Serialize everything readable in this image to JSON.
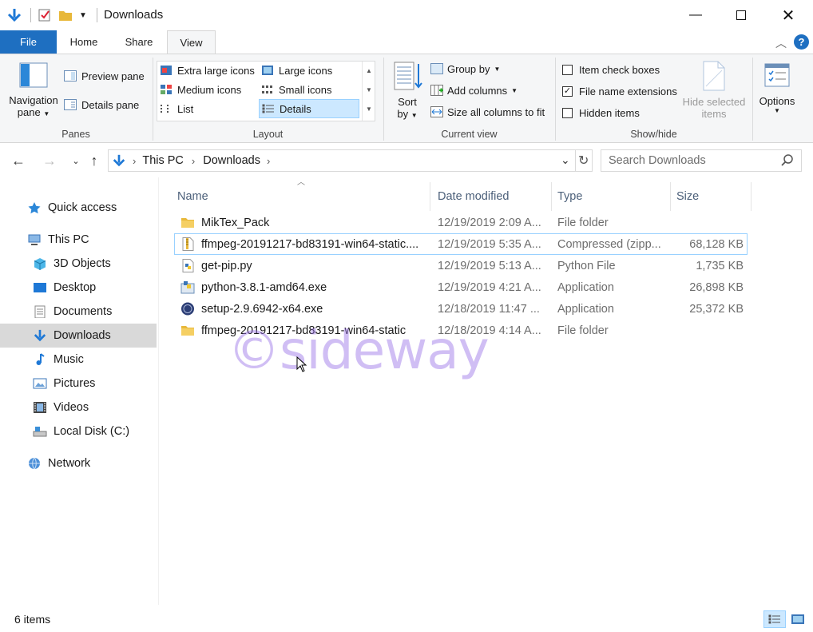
{
  "window": {
    "title": "Downloads"
  },
  "tabs": [
    {
      "label": "File"
    },
    {
      "label": "Home"
    },
    {
      "label": "Share"
    },
    {
      "label": "View"
    }
  ],
  "ribbon": {
    "panes": {
      "label": "Panes",
      "navigation_pane_line1": "Navigation",
      "navigation_pane_line2": "pane",
      "preview_pane": "Preview pane",
      "details_pane": "Details pane"
    },
    "layout": {
      "label": "Layout",
      "items": [
        {
          "label": "Extra large icons"
        },
        {
          "label": "Large icons"
        },
        {
          "label": "Medium icons"
        },
        {
          "label": "Small icons"
        },
        {
          "label": "List"
        },
        {
          "label": "Details"
        }
      ],
      "selected": "Details"
    },
    "current_view": {
      "label": "Current view",
      "sort_line1": "Sort",
      "sort_line2": "by",
      "group_by": "Group by",
      "add_columns": "Add columns",
      "size_all_columns": "Size all columns to fit"
    },
    "show_hide": {
      "label": "Show/hide",
      "item_check_boxes": {
        "label": "Item check boxes",
        "checked": false
      },
      "file_name_extensions": {
        "label": "File name extensions",
        "checked": true
      },
      "hidden_items": {
        "label": "Hidden items",
        "checked": false
      },
      "hide_selected_line1": "Hide selected",
      "hide_selected_line2": "items"
    },
    "options": {
      "label": "Options"
    }
  },
  "address": {
    "crumbs": [
      "This PC",
      "Downloads"
    ],
    "search_placeholder": "Search Downloads"
  },
  "nav": {
    "items": [
      {
        "label": "Quick access"
      },
      {
        "label": "This PC"
      },
      {
        "label": "3D Objects"
      },
      {
        "label": "Desktop"
      },
      {
        "label": "Documents"
      },
      {
        "label": "Downloads"
      },
      {
        "label": "Music"
      },
      {
        "label": "Pictures"
      },
      {
        "label": "Videos"
      },
      {
        "label": "Local Disk (C:)"
      },
      {
        "label": "Network"
      }
    ]
  },
  "files": {
    "columns": [
      "Name",
      "Date modified",
      "Type",
      "Size"
    ],
    "rows": [
      {
        "name": "MikTex_Pack",
        "date": "12/19/2019 2:09 A...",
        "type": "File folder",
        "size": ""
      },
      {
        "name": "ffmpeg-20191217-bd83191-win64-static....",
        "date": "12/19/2019 5:35 A...",
        "type": "Compressed (zipp...",
        "size": "68,128 KB"
      },
      {
        "name": "get-pip.py",
        "date": "12/19/2019 5:13 A...",
        "type": "Python File",
        "size": "1,735 KB"
      },
      {
        "name": "python-3.8.1-amd64.exe",
        "date": "12/19/2019 4:21 A...",
        "type": "Application",
        "size": "26,898 KB"
      },
      {
        "name": "setup-2.9.6942-x64.exe",
        "date": "12/18/2019 11:47 ...",
        "type": "Application",
        "size": "25,372 KB"
      },
      {
        "name": "ffmpeg-20191217-bd83191-win64-static",
        "date": "12/18/2019 4:14 A...",
        "type": "File folder",
        "size": ""
      }
    ]
  },
  "status": {
    "text": "6 items"
  },
  "watermark": "©sideway",
  "colors": {
    "accent": "#1e6fc1",
    "folder": "#e8b83a",
    "selected_nav": "#d9d9d9"
  }
}
